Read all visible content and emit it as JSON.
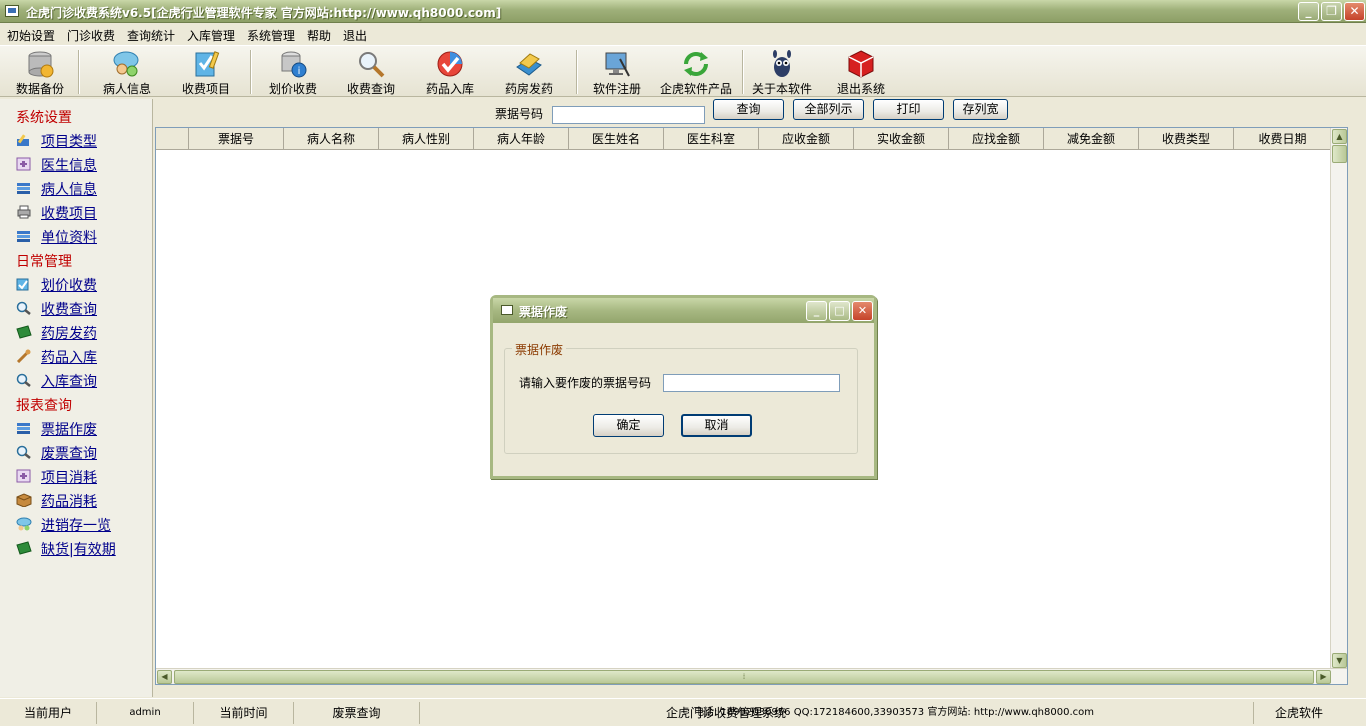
{
  "window": {
    "title": "企虎门诊收费系统v6.5[企虎行业管理软件专家  官方网站:http://www.qh8000.com]",
    "minimize": "_",
    "restore": "❐",
    "close": "✕"
  },
  "menu": [
    "初始设置",
    "门诊收费",
    "查询统计",
    "入库管理",
    "系统管理",
    "帮助",
    "退出"
  ],
  "toolbar": [
    {
      "label": "数据备份",
      "icon": "database-backup-icon"
    },
    {
      "label": "病人信息",
      "icon": "patient-chat-icon"
    },
    {
      "label": "收费项目",
      "icon": "charge-items-icon"
    },
    {
      "label": "划价收费",
      "icon": "pricing-database-icon"
    },
    {
      "label": "收费查询",
      "icon": "magnifier-icon"
    },
    {
      "label": "药品入库",
      "icon": "check-badge-icon"
    },
    {
      "label": "药房发药",
      "icon": "pharmacy-box-icon"
    },
    {
      "label": "软件注册",
      "icon": "register-monitor-icon"
    },
    {
      "label": "企虎软件产品",
      "icon": "refresh-arrows-icon"
    },
    {
      "label": "关于本软件",
      "icon": "about-mascot-icon"
    },
    {
      "label": "退出系统",
      "icon": "exit-cube-icon"
    }
  ],
  "sidebar": {
    "groups": [
      {
        "title": "系统设置",
        "items": [
          {
            "label": "项目类型",
            "icon": "pencil-book-icon"
          },
          {
            "label": "医生信息",
            "icon": "doctor-card-icon"
          },
          {
            "label": "病人信息",
            "icon": "books-stack-icon"
          },
          {
            "label": "收费项目",
            "icon": "printer-icon"
          },
          {
            "label": "单位资料",
            "icon": "books-stack-icon"
          }
        ]
      },
      {
        "title": "日常管理",
        "items": [
          {
            "label": "划价收费",
            "icon": "notes-pencil-icon"
          },
          {
            "label": "收费查询",
            "icon": "magnifier-icon"
          },
          {
            "label": "药房发药",
            "icon": "green-book-icon"
          },
          {
            "label": "药品入库",
            "icon": "wrench-icon"
          },
          {
            "label": "入库查询",
            "icon": "magnifier-icon"
          }
        ]
      },
      {
        "title": "报表查询",
        "items": [
          {
            "label": "票据作废",
            "icon": "books-stack-icon"
          },
          {
            "label": "废票查询",
            "icon": "magnifier-icon"
          },
          {
            "label": "项目消耗",
            "icon": "doctor-card-icon"
          },
          {
            "label": "药品消耗",
            "icon": "package-box-icon"
          },
          {
            "label": "进销存一览",
            "icon": "people-chat-icon"
          },
          {
            "label": "缺货|有效期",
            "icon": "green-book-icon"
          }
        ]
      }
    ]
  },
  "search": {
    "label": "票据号码",
    "value": "",
    "buttons": [
      "查询",
      "全部列示",
      "打印",
      "存列宽"
    ]
  },
  "grid": {
    "columns": [
      "票据号",
      "病人名称",
      "病人性别",
      "病人年龄",
      "医生姓名",
      "医生科室",
      "应收金额",
      "实收金额",
      "应找金额",
      "减免金额",
      "收费类型",
      "收费日期"
    ],
    "rows": []
  },
  "dialog": {
    "title": "票据作废",
    "group_label": "票据作废",
    "prompt": "请输入要作废的票据号码",
    "input_value": "",
    "ok": "确定",
    "cancel": "取消"
  },
  "status": {
    "user_label": "当前用户",
    "user": "admin",
    "time_label": "当前时间",
    "current": "废票查询",
    "system": "企虎门诊收费管理系统",
    "contact": "电话: 18992030956 QQ:172184600,33903573  官方网站: http://www.qh8000.com",
    "brand": "企虎软件"
  },
  "colors": {
    "accent": "#a7b882",
    "group_title": "#c00000",
    "link": "#00008b"
  }
}
